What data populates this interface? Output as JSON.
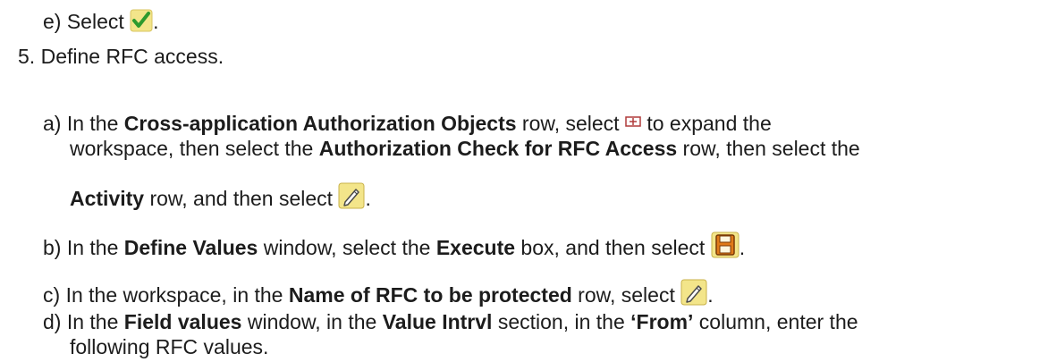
{
  "step_e_prev": {
    "marker": "e)",
    "text": "Select",
    "end": ".",
    "icon": "checkmark-icon"
  },
  "step5": {
    "marker": "5.",
    "text": "Define RFC access.",
    "substeps": {
      "a": {
        "marker": "a)",
        "line1_t1": "In the ",
        "line1_b1": "Cross-application Authorization Objects",
        "line1_t2": " row, select ",
        "line1_t3": " to expand the",
        "line2_t1": "workspace, then select the ",
        "line2_b1": "Authorization Check for RFC Access",
        "line2_t2": " row, then select the",
        "line3_b1": "Activity",
        "line3_t1": " row, and then select ",
        "line3_end": ".",
        "icons": [
          "expand-tree-icon",
          "pencil-edit-icon"
        ]
      },
      "b": {
        "marker": "b)",
        "t1": "In the ",
        "b1": "Define Values",
        "t2": " window, select the ",
        "b2": "Execute",
        "t3": " box, and then select ",
        "end": ".",
        "icon": "save-icon"
      },
      "c": {
        "marker": "c)",
        "t1": "In the workspace, in the ",
        "b1": "Name of RFC to be protected",
        "t2": " row, select ",
        "end": ".",
        "icon": "pencil-edit-icon"
      },
      "d": {
        "marker": "d)",
        "t1": "In the ",
        "b1": "Field values",
        "t2": " window, in the ",
        "b2": "Value Intrvl",
        "t3": " section, in the ",
        "b3": "‘From’",
        "t4": " column, enter the",
        "line2": "following RFC values."
      }
    }
  },
  "colors": {
    "text": "#1c1c1c",
    "check_green": "#2e9a2e",
    "icon_yellow": "#f3e58a",
    "save_orange": "#e07a1a"
  }
}
